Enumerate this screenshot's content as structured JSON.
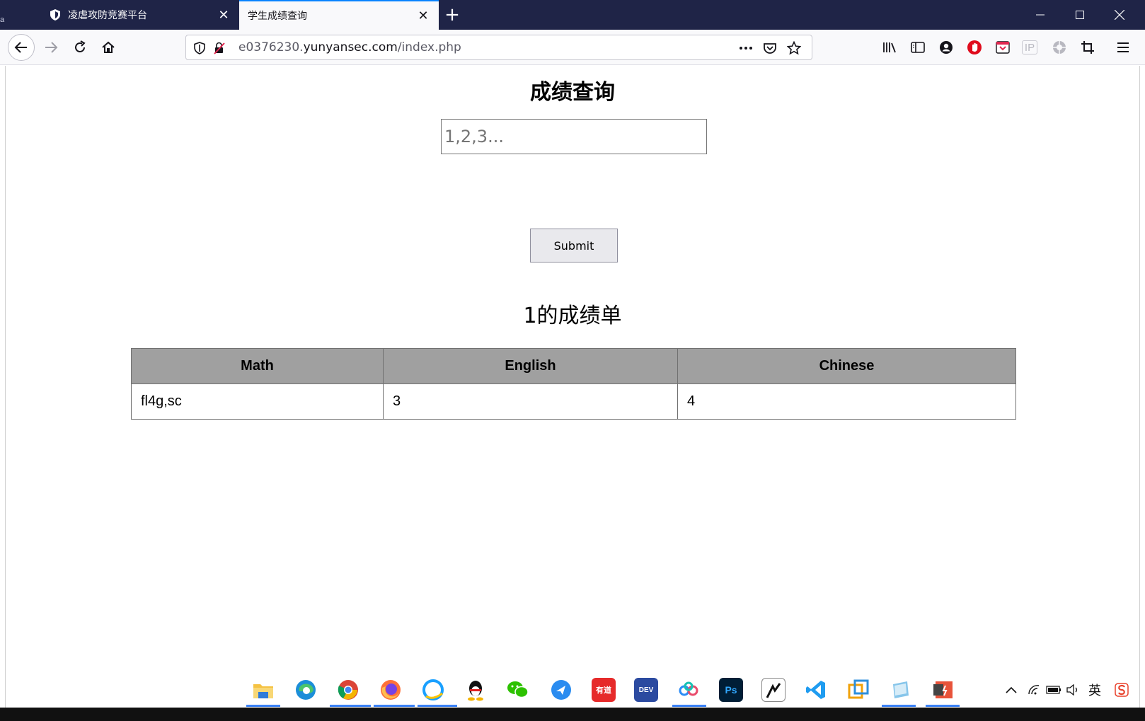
{
  "browser": {
    "left_edge_text": "a",
    "tabs": [
      {
        "title": "凌虐攻防竞赛平台",
        "active": false
      },
      {
        "title": "学生成绩查询",
        "active": true
      }
    ],
    "url": {
      "prefix": "e0376230.",
      "domain": "yunyansec.com",
      "path": "/index.php"
    },
    "toolbar_text": {
      "ip_label": "IP"
    }
  },
  "page": {
    "title": "成绩查询",
    "input": {
      "value": "",
      "placeholder": "1,2,3..."
    },
    "submit_label": "Submit",
    "result_heading": "1的成绩单",
    "table": {
      "headers": [
        "Math",
        "English",
        "Chinese"
      ],
      "rows": [
        [
          "fl4g,sc",
          "3",
          "4"
        ]
      ]
    }
  },
  "taskbar": {
    "ime_label": "英",
    "apps": [
      "file-explorer",
      "edge",
      "chrome",
      "firefox",
      "qq-browser",
      "qq",
      "wechat",
      "feishu",
      "youdao",
      "dev-cpp",
      "baidu-netdisk",
      "photoshop",
      "typora",
      "vscode",
      "vmware",
      "notepad",
      "powerpoint"
    ],
    "app_labels": {
      "youdao": "有道",
      "dev": "DEV",
      "ps": "Ps"
    }
  },
  "colors": {
    "tabstrip": "#1f2447",
    "active_tab_accent": "#0a84ff",
    "table_header": "#a0a0a0"
  }
}
